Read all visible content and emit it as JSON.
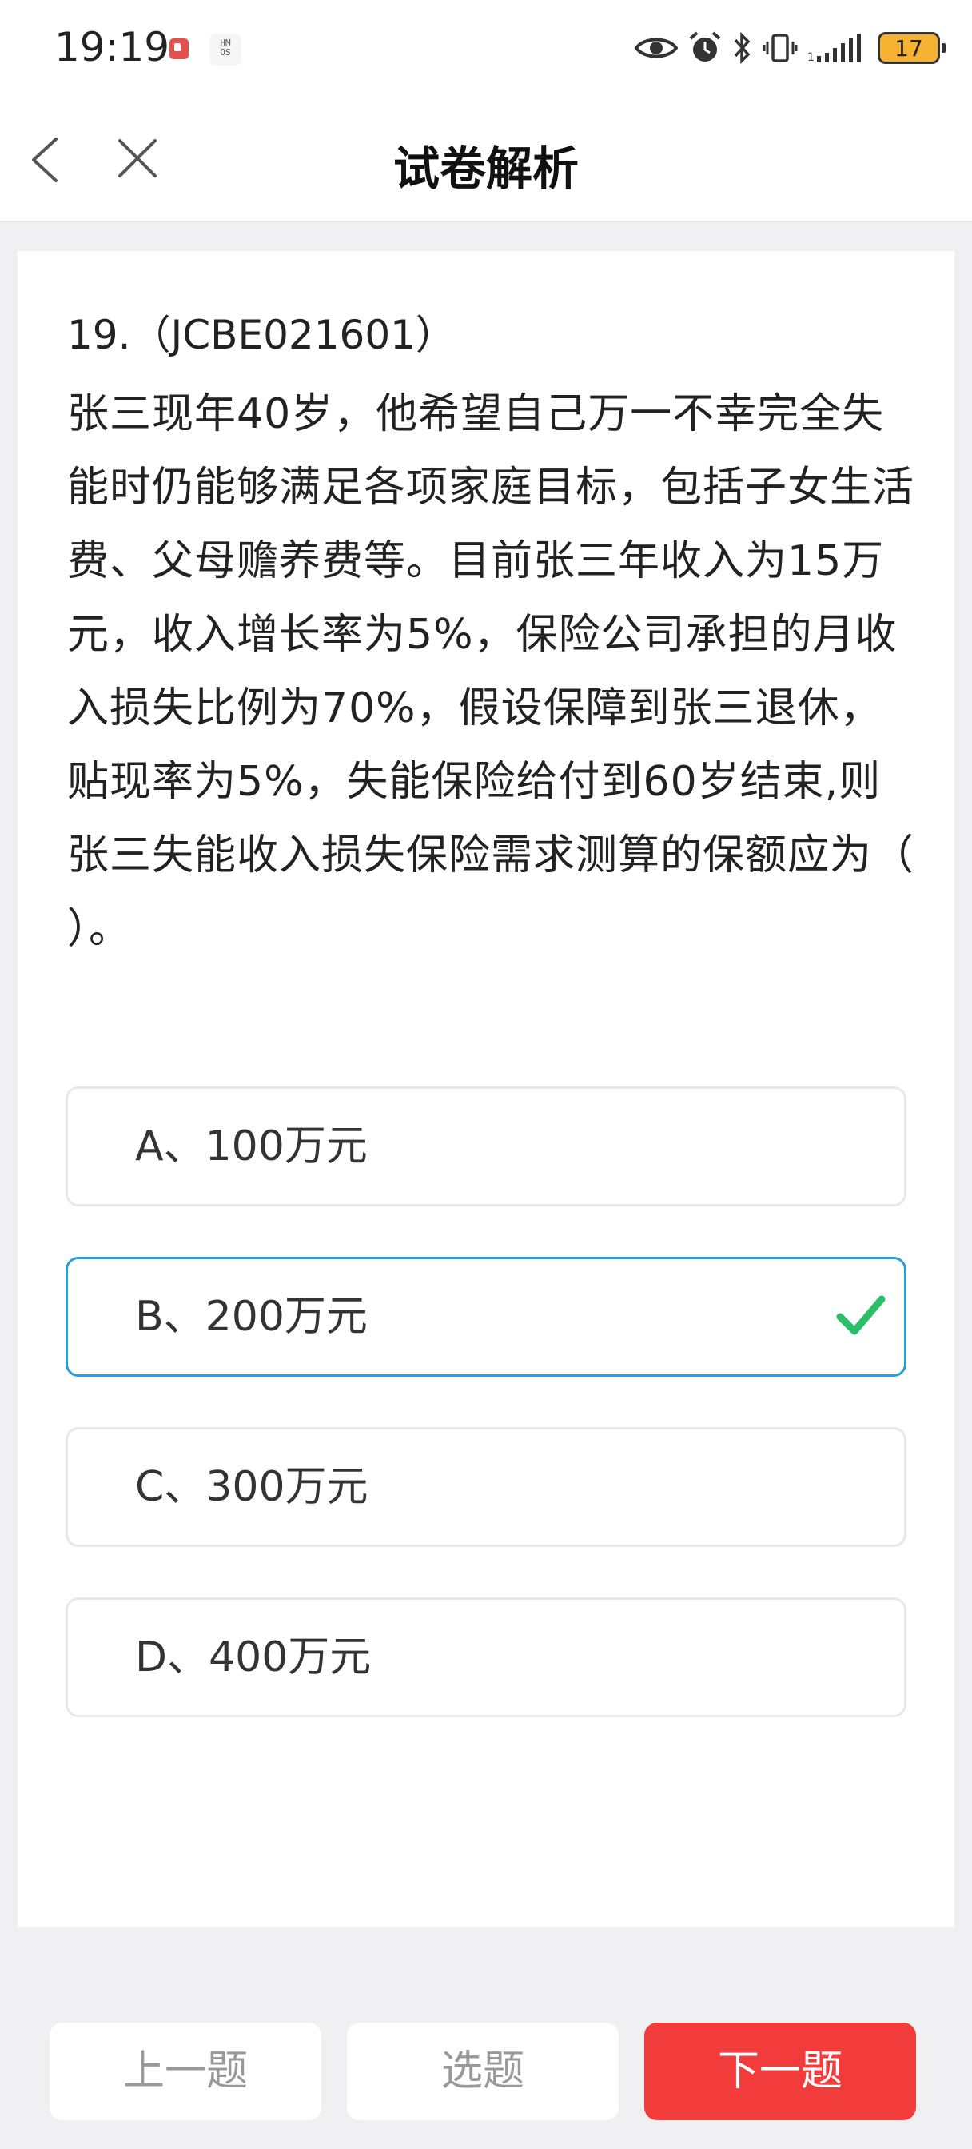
{
  "status": {
    "time": "19:19",
    "hmos_badge": "HM\nOS",
    "battery": "17",
    "signal_small": "1"
  },
  "nav": {
    "title": "试卷解析"
  },
  "question": {
    "number": "19.（JCBE021601）",
    "text": "张三现年40岁，他希望自己万一不幸完全失能时仍能够满足各项家庭目标，包括子女生活费、父母赡养费等。目前张三年收入为15万元，收入增长率为5%，保险公司承担的月收入损失比例为70%，假设保障到张三退休，贴现率为5%，失能保险给付到60岁结束,则张三失能收入损失保险需求测算的保额应为（    ）。"
  },
  "options": [
    {
      "label": "A、100万元"
    },
    {
      "label": "B、200万元",
      "correct": true
    },
    {
      "label": "C、300万元"
    },
    {
      "label": "D、400万元"
    }
  ],
  "buttons": {
    "prev": "上一题",
    "select": "选题",
    "next": "下一题"
  },
  "colors": {
    "accent_border": "#2a9fd8",
    "check": "#2bbf6a",
    "next_button": "#f23c3c"
  }
}
